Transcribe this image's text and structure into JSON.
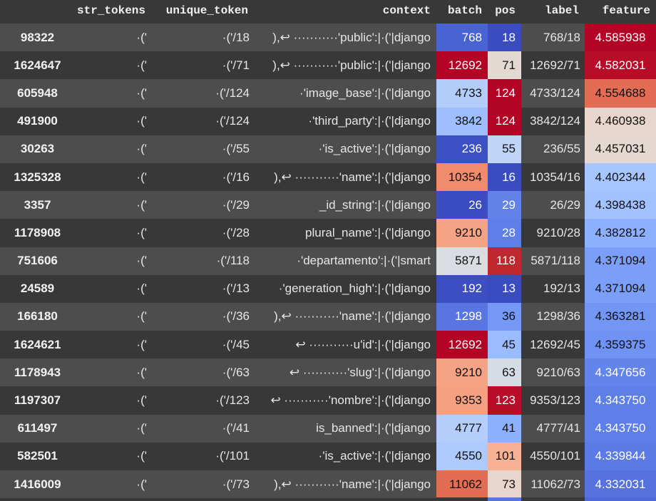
{
  "headers": {
    "index": "",
    "str_tokens": "str_tokens",
    "unique_token": "unique_token",
    "context": "context",
    "batch": "batch",
    "pos": "pos",
    "label": "label",
    "feature": "feature"
  },
  "colors": {
    "row_odd": "#4d4d4d",
    "row_even": "#383838",
    "header_bg": "#383838",
    "heat_low": "#3b4cc0",
    "heat_mid": "#dddcdc",
    "heat_high": "#b40426"
  },
  "rows": [
    {
      "index": "98322",
      "str_tokens": "·('",
      "unique_token": "·('/18",
      "context": "),↩ ···········'public':|·('|django",
      "batch": "768",
      "pos": "18",
      "label": "768/18",
      "feature": "4.585938",
      "batch_color": "#4a63d3",
      "pos_color": "#3b4cc0",
      "feature_color": "#b40426"
    },
    {
      "index": "1624647",
      "str_tokens": "·('",
      "unique_token": "·('/71",
      "context": "),↩ ···········'public':|·('|django",
      "batch": "12692",
      "pos": "71",
      "label": "12692/71",
      "feature": "4.582031",
      "batch_color": "#b40426",
      "pos_color": "#e4d9d2",
      "feature_color": "#b70d28"
    },
    {
      "index": "605948",
      "str_tokens": "·('",
      "unique_token": "·('/124",
      "context": "·'image_base':|·('|django",
      "batch": "4733",
      "pos": "124",
      "label": "4733/124",
      "feature": "4.554688",
      "batch_color": "#b3cdfb",
      "pos_color": "#b40426",
      "feature_color": "#e36c55"
    },
    {
      "index": "491900",
      "str_tokens": "·('",
      "unique_token": "·('/124",
      "context": "·'third_party':|·('|django",
      "batch": "3842",
      "pos": "124",
      "label": "3842/124",
      "feature": "4.460938",
      "batch_color": "#9ebeff",
      "pos_color": "#b40426",
      "feature_color": "#e8d6cc"
    },
    {
      "index": "30263",
      "str_tokens": "·('",
      "unique_token": "·('/55",
      "context": "·'is_active':|·('|django",
      "batch": "236",
      "pos": "55",
      "label": "236/55",
      "feature": "4.457031",
      "batch_color": "#3d50c3",
      "pos_color": "#c0d4f5",
      "feature_color": "#e5d8d1"
    },
    {
      "index": "1325328",
      "str_tokens": "·('",
      "unique_token": "·('/16",
      "context": "),↩ ···········'name':|·('|django",
      "batch": "10354",
      "pos": "16",
      "label": "10354/16",
      "feature": "4.402344",
      "batch_color": "#f08b6e",
      "pos_color": "#3b4cc0",
      "feature_color": "#a7c5fe"
    },
    {
      "index": "3357",
      "str_tokens": "·('",
      "unique_token": "·('/29",
      "context": "_id_string':|·('|django",
      "batch": "26",
      "pos": "29",
      "label": "26/29",
      "feature": "4.398438",
      "batch_color": "#3b4cc0",
      "pos_color": "#6282ea",
      "feature_color": "#a2c1ff"
    },
    {
      "index": "1178908",
      "str_tokens": "·('",
      "unique_token": "·('/28",
      "context": "plural_name':|·('|django",
      "batch": "9210",
      "pos": "28",
      "label": "9210/28",
      "feature": "4.382812",
      "batch_color": "#f6a385",
      "pos_color": "#5f7fe8",
      "feature_color": "#8caffe"
    },
    {
      "index": "751606",
      "str_tokens": "·('",
      "unique_token": "·('/118",
      "context": "·'departamento':|·('|smart",
      "batch": "5871",
      "pos": "118",
      "label": "5871/118",
      "feature": "4.371094",
      "batch_color": "#d9dce1",
      "pos_color": "#c0282f",
      "feature_color": "#7b9ff9"
    },
    {
      "index": "24589",
      "str_tokens": "·('",
      "unique_token": "·('/13",
      "context": "·'generation_high':|·('|django",
      "batch": "192",
      "pos": "13",
      "label": "192/13",
      "feature": "4.371094",
      "batch_color": "#3c4ec2",
      "pos_color": "#3b4cc0",
      "feature_color": "#7b9ff9"
    },
    {
      "index": "166180",
      "str_tokens": "·('",
      "unique_token": "·('/36",
      "context": "),↩ ···········'name':|·('|django",
      "batch": "1298",
      "pos": "36",
      "label": "1298/36",
      "feature": "4.363281",
      "batch_color": "#5875e1",
      "pos_color": "#7597f6",
      "feature_color": "#7396f5"
    },
    {
      "index": "1624621",
      "str_tokens": "·('",
      "unique_token": "·('/45",
      "context": "↩ ···········u'id':|·('|django",
      "batch": "12692",
      "pos": "45",
      "label": "12692/45",
      "feature": "4.359375",
      "batch_color": "#b40426",
      "pos_color": "#9abbff",
      "feature_color": "#6f92f3"
    },
    {
      "index": "1178943",
      "str_tokens": "·('",
      "unique_token": "·('/63",
      "context": "↩ ···········'slug':|·('|django",
      "batch": "9210",
      "pos": "63",
      "label": "9210/63",
      "feature": "4.347656",
      "batch_color": "#f6a385",
      "pos_color": "#d6dce4",
      "feature_color": "#6384eb"
    },
    {
      "index": "1197307",
      "str_tokens": "·('",
      "unique_token": "·('/123",
      "context": "↩ ···········'nombre':|·('|django",
      "batch": "9353",
      "pos": "123",
      "label": "9353/123",
      "feature": "4.343750",
      "batch_color": "#f5a081",
      "pos_color": "#b70d28",
      "feature_color": "#5f7fe8"
    },
    {
      "index": "611497",
      "str_tokens": "·('",
      "unique_token": "·('/41",
      "context": "is_banned':|·('|django",
      "batch": "4777",
      "pos": "41",
      "label": "4777/41",
      "feature": "4.343750",
      "batch_color": "#b5cdfa",
      "pos_color": "#8caffe",
      "feature_color": "#5f7fe8"
    },
    {
      "index": "582501",
      "str_tokens": "·('",
      "unique_token": "·('/101",
      "context": "·'is_active':|·('|django",
      "batch": "4550",
      "pos": "101",
      "label": "4550/101",
      "feature": "4.339844",
      "batch_color": "#aec9fc",
      "pos_color": "#f7b194",
      "feature_color": "#5b7ae5"
    },
    {
      "index": "1416009",
      "str_tokens": "·('",
      "unique_token": "·('/73",
      "context": "),↩ ···········'name':|·('|django",
      "batch": "11062",
      "pos": "73",
      "label": "11062/73",
      "feature": "4.332031",
      "batch_color": "#e36c55",
      "pos_color": "#e8d6cc",
      "feature_color": "#5572df"
    }
  ]
}
